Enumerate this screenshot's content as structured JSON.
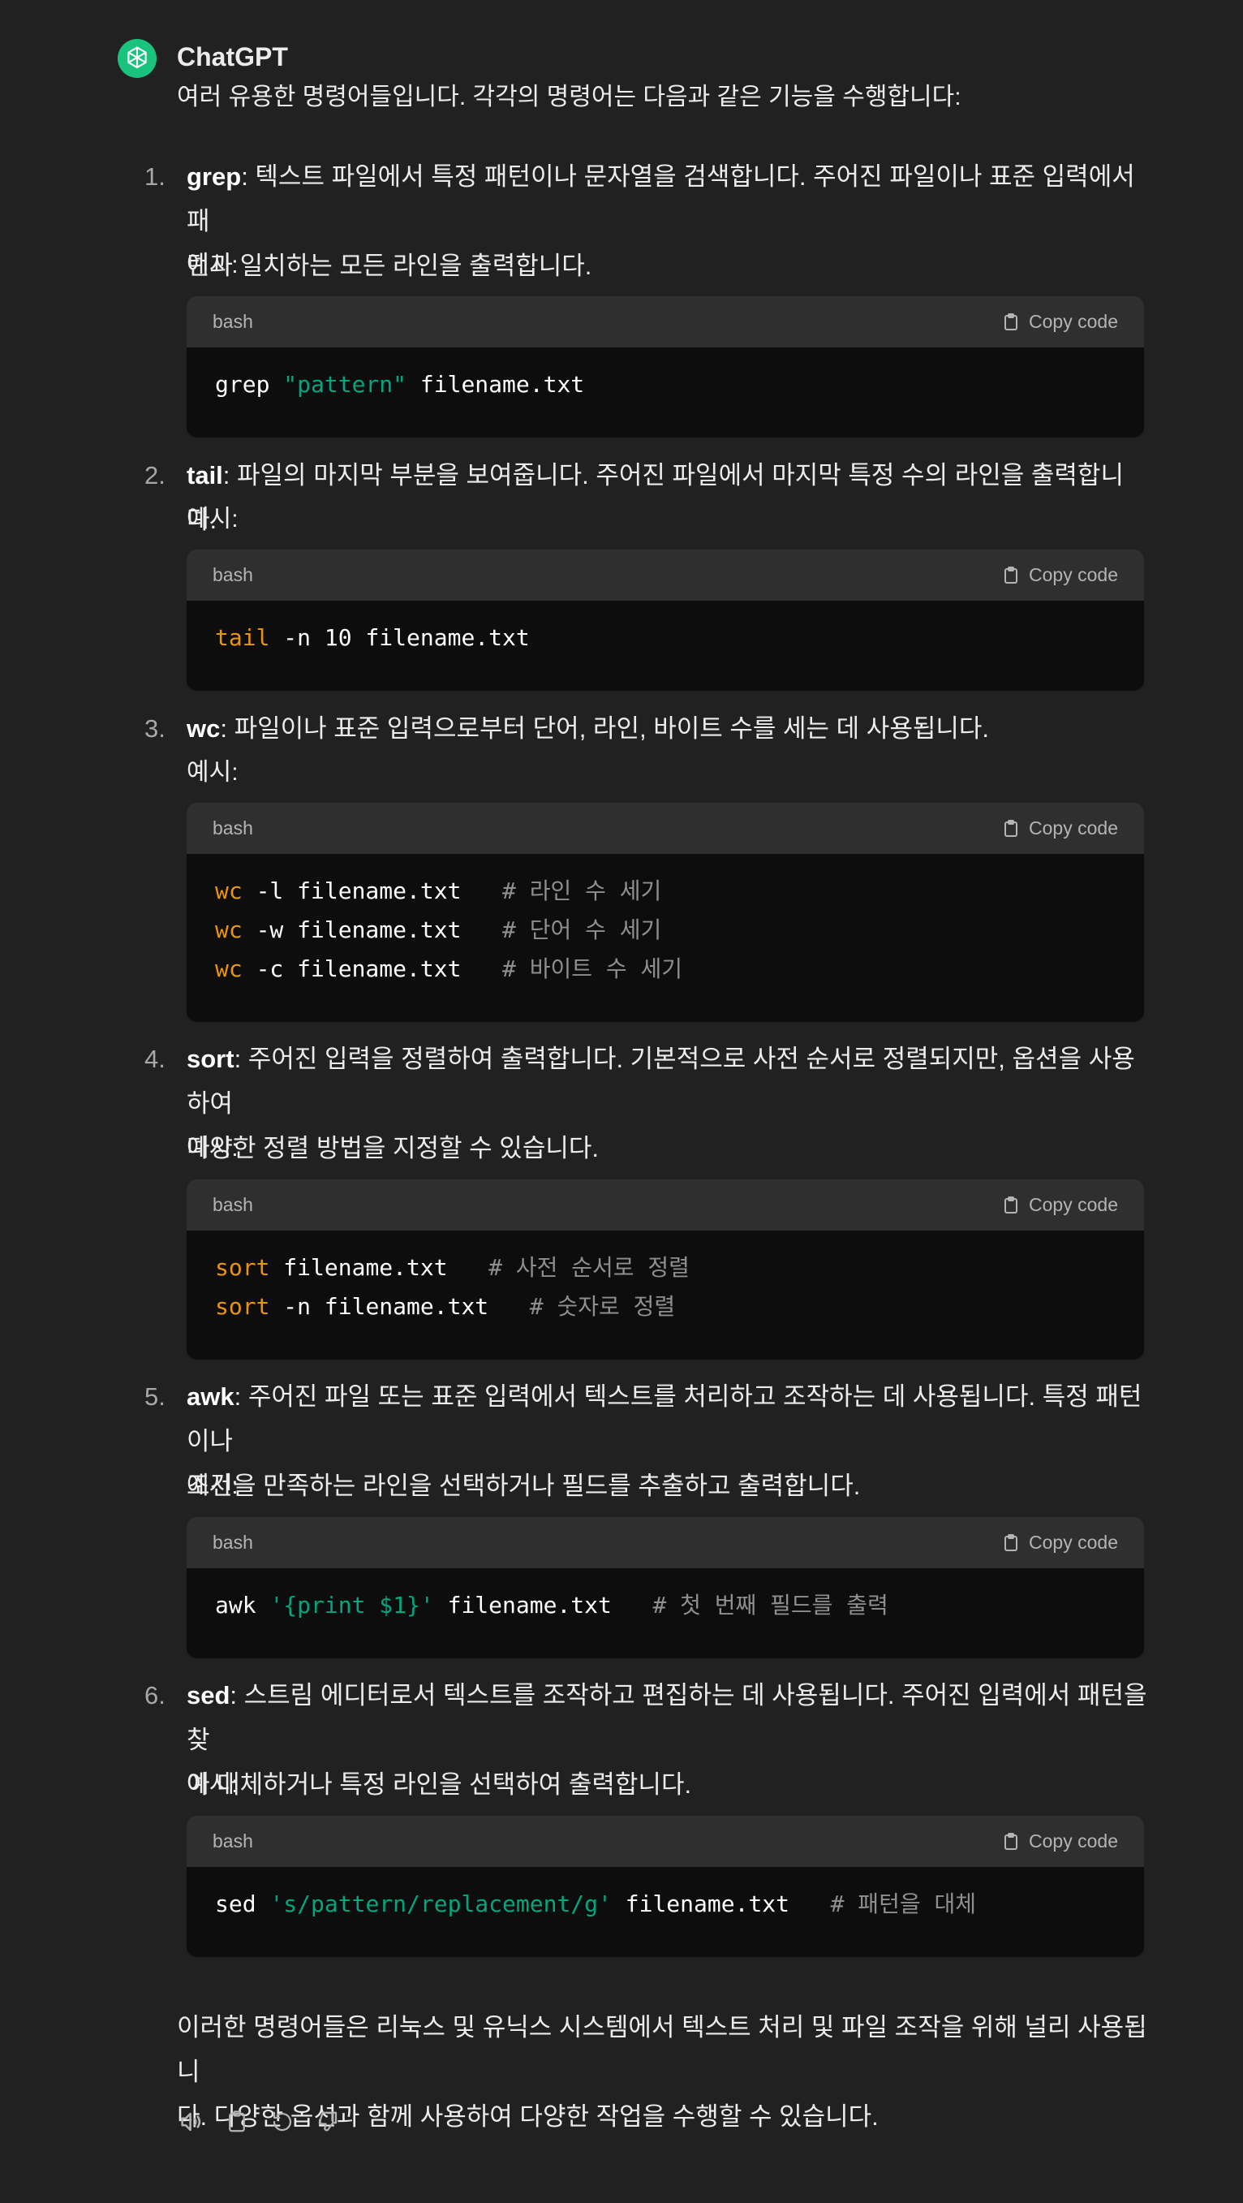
{
  "assistant": {
    "name": "ChatGPT",
    "avatar_color": "#19c37d",
    "avatar_icon": "openai-logo-icon"
  },
  "intro": "여러 유용한 명령어들입니다. 각각의 명령어는 다음과 같은 기능을 수행합니다:",
  "example_label": "예시:",
  "copy_label": "Copy code",
  "code_language": "bash",
  "items": [
    {
      "number": "1.",
      "term": "grep",
      "description_line1": ": 텍스트 파일에서 특정 패턴이나 문자열을 검색합니다. 주어진 파일이나 표준 입력에서 패",
      "description_line2": "턴과 일치하는 모든 라인을 출력합니다.",
      "code": [
        {
          "cmd": "grep",
          "cmd_highlight": false,
          "arg_str": "\"pattern\"",
          "rest": " filename.txt",
          "comment": ""
        }
      ]
    },
    {
      "number": "2.",
      "term": "tail",
      "description_line1": ": 파일의 마지막 부분을 보여줍니다. 주어진 파일에서 마지막 특정 수의 라인을 출력합니다.",
      "description_line2": "",
      "code": [
        {
          "cmd": "tail",
          "cmd_highlight": true,
          "arg_str": "",
          "rest": " -n 10 filename.txt",
          "comment": ""
        }
      ]
    },
    {
      "number": "3.",
      "term": "wc",
      "description_line1": ": 파일이나 표준 입력으로부터 단어, 라인, 바이트 수를 세는 데 사용됩니다.",
      "description_line2": "",
      "code": [
        {
          "cmd": "wc",
          "cmd_highlight": true,
          "arg_str": "",
          "rest": " -l filename.txt   ",
          "comment": "# 라인 수 세기"
        },
        {
          "cmd": "wc",
          "cmd_highlight": true,
          "arg_str": "",
          "rest": " -w filename.txt   ",
          "comment": "# 단어 수 세기"
        },
        {
          "cmd": "wc",
          "cmd_highlight": true,
          "arg_str": "",
          "rest": " -c filename.txt   ",
          "comment": "# 바이트 수 세기"
        }
      ]
    },
    {
      "number": "4.",
      "term": "sort",
      "description_line1": ": 주어진 입력을 정렬하여 출력합니다. 기본적으로 사전 순서로 정렬되지만, 옵션을 사용하여",
      "description_line2": "다양한 정렬 방법을 지정할 수 있습니다.",
      "code": [
        {
          "cmd": "sort",
          "cmd_highlight": true,
          "arg_str": "",
          "rest": " filename.txt   ",
          "comment": "# 사전 순서로 정렬"
        },
        {
          "cmd": "sort",
          "cmd_highlight": true,
          "arg_str": "",
          "rest": " -n filename.txt   ",
          "comment": "# 숫자로 정렬"
        }
      ]
    },
    {
      "number": "5.",
      "term": "awk",
      "description_line1": ": 주어진 파일 또는 표준 입력에서 텍스트를 처리하고 조작하는 데 사용됩니다. 특정 패턴이나",
      "description_line2": "조건을 만족하는 라인을 선택하거나 필드를 추출하고 출력합니다.",
      "code": [
        {
          "cmd": "awk",
          "cmd_highlight": false,
          "arg_str": "'{print $1}'",
          "rest": " filename.txt   ",
          "comment": "# 첫 번째 필드를 출력"
        }
      ]
    },
    {
      "number": "6.",
      "term": "sed",
      "description_line1": ": 스트림 에디터로서 텍스트를 조작하고 편집하는 데 사용됩니다. 주어진 입력에서 패턴을 찾",
      "description_line2": "아 대체하거나 특정 라인을 선택하여 출력합니다.",
      "code": [
        {
          "cmd": "sed",
          "cmd_highlight": false,
          "arg_str": "'s/pattern/replacement/g'",
          "rest": " filename.txt   ",
          "comment": "# 패턴을 대체"
        }
      ]
    }
  ],
  "outro_line1": "이러한 명령어들은 리눅스 및 유닉스 시스템에서 텍스트 처리 및 파일 조작을 위해 널리 사용됩니",
  "outro_line2": "다. 다양한 옵션과 함께 사용하여 다양한 작업을 수행할 수 있습니다.",
  "actions": [
    "read-aloud-icon",
    "copy-icon",
    "regenerate-icon",
    "thumbs-down-icon"
  ],
  "colors": {
    "background": "#212121",
    "code_header": "#2f2f2f",
    "code_body": "#0d0d0d",
    "keyword": "#e9950c",
    "string": "#00a67d",
    "comment": "#8f8f8f"
  }
}
